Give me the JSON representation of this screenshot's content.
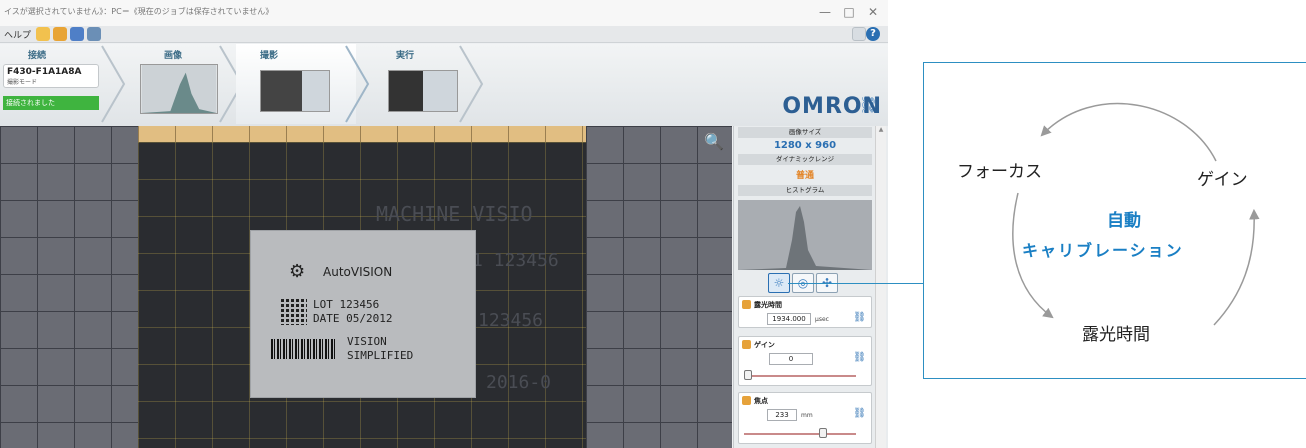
{
  "window": {
    "title": "イスが選択されていません》：PC＝《現在のジョブは保存されていません》",
    "minimize": "—",
    "maximize": "□",
    "close": "✕"
  },
  "menu": {
    "help": "ヘルプ"
  },
  "steps": [
    {
      "label": "接続"
    },
    {
      "label": "画像"
    },
    {
      "label": "撮影"
    },
    {
      "label": "実行"
    }
  ],
  "connection": {
    "model": "F430-F1A1A8A",
    "mode": "撮影モード",
    "status": "接続されました"
  },
  "brand": "OMRON",
  "viewer": {
    "background_text_1": "MACHINE VISIO",
    "background_text_2": "1 123456",
    "background_text_3": "123456",
    "background_text_4": "2016-0",
    "logo_text": "AutoVISION",
    "lot_line_1": "LOT 123456",
    "lot_line_2": "DATE 05/2012",
    "vision_line_1": "VISION",
    "vision_line_2": "SIMPLIFIED"
  },
  "panel": {
    "image_size_header": "画像サイズ",
    "image_size_value": "1280 x 960",
    "dynamic_range_header": "ダイナミックレンジ",
    "dynamic_range_value": "普通",
    "histogram_header": "ヒストグラム",
    "exposure_title": "露光時間",
    "exposure_value": "1934.000",
    "exposure_unit": "μsec",
    "gain_title": "ゲイン",
    "gain_value": "0",
    "gain_level": 0.0,
    "focus_title": "焦点",
    "focus_value": "233",
    "focus_unit": "mm",
    "focus_level": 0.72
  },
  "callout": {
    "focus": "フォーカス",
    "gain": "ゲイン",
    "exposure": "露光時間",
    "auto_line_1": "自動",
    "auto_line_2": "キャリブレーション",
    "accent_color": "#1a7fc4",
    "arrow_color": "#9a9a9a"
  }
}
